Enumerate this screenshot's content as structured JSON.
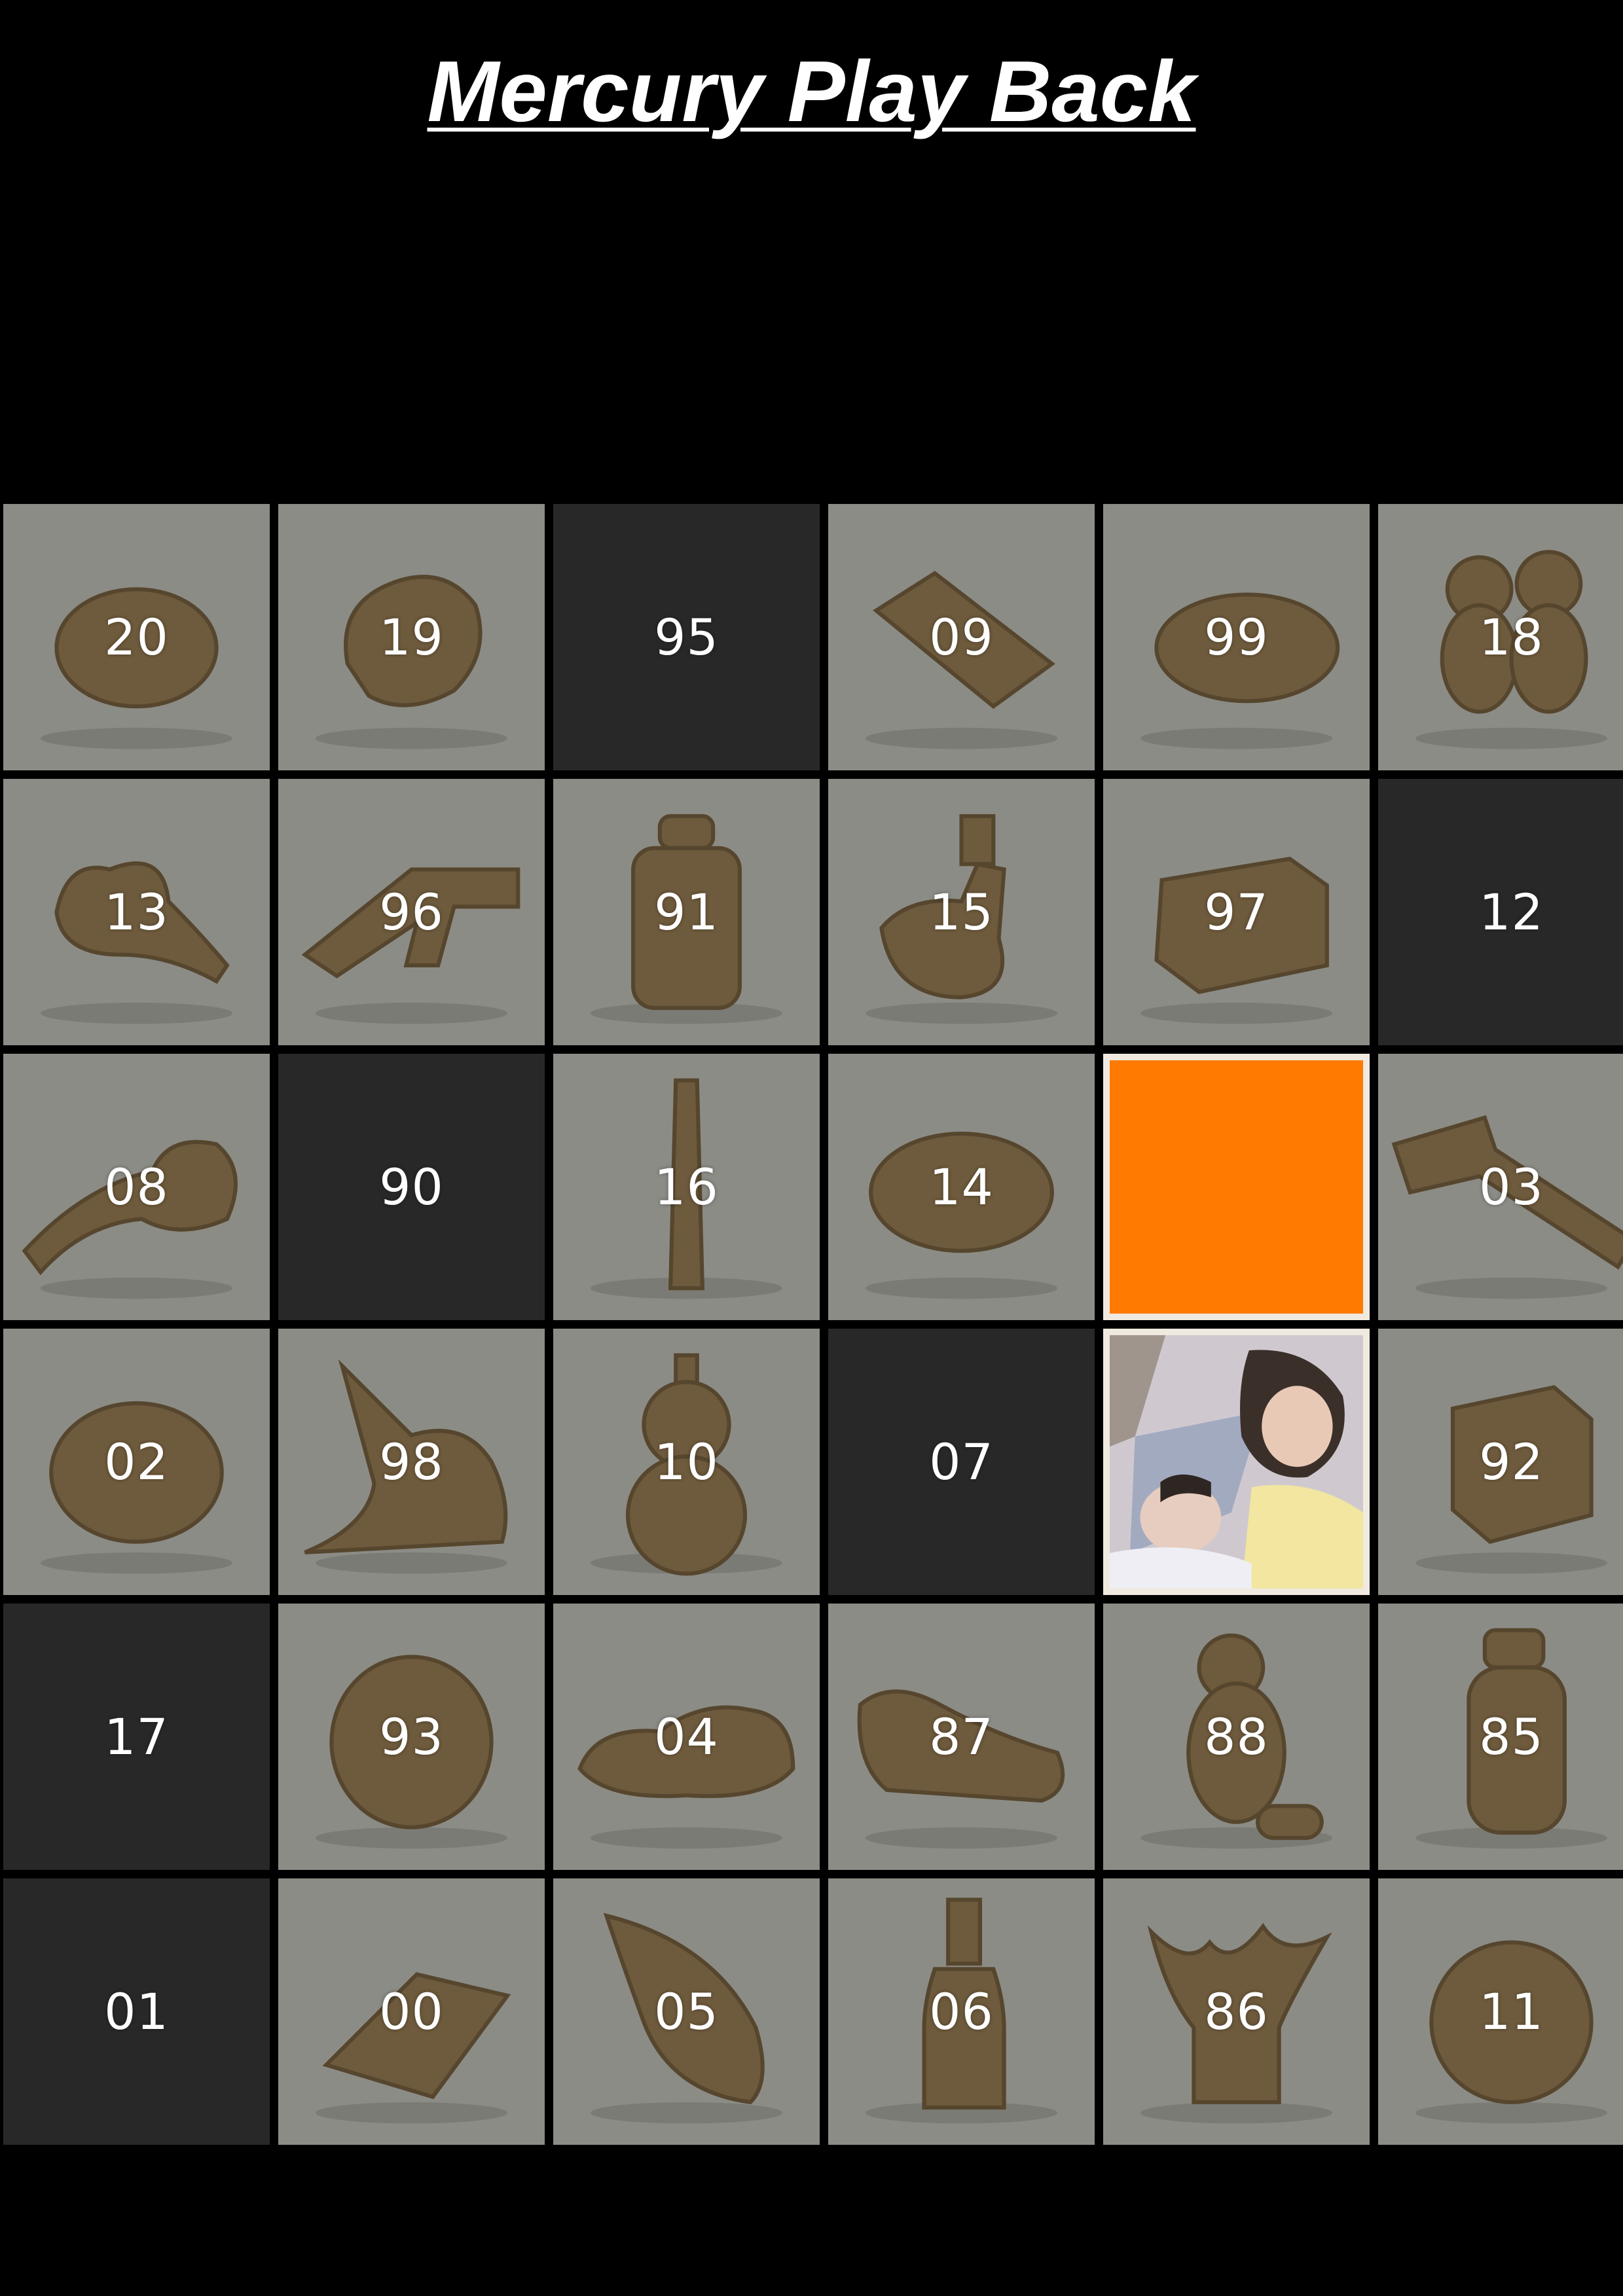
{
  "header": {
    "title": "Mercury Play Back"
  },
  "colors": {
    "background": "#000000",
    "photo_tile": "#8c8c86",
    "empty_tile": "#282828",
    "accent_tile": "#ff7a00",
    "highlight_border": "#efe9df",
    "clay": "#6e5a3c"
  },
  "grid": {
    "rows": [
      [
        {
          "label": "20",
          "kind": "photo",
          "object": "lump-icon"
        },
        {
          "label": "19",
          "kind": "photo",
          "object": "crumpled-lump-icon"
        },
        {
          "label": "95",
          "kind": "empty",
          "object": ""
        },
        {
          "label": "09",
          "kind": "photo",
          "object": "slab-icon"
        },
        {
          "label": "99",
          "kind": "photo",
          "object": "bread-icon"
        },
        {
          "label": "18",
          "kind": "photo",
          "object": "teddy-bears-icon"
        }
      ],
      [
        {
          "label": "13",
          "kind": "photo",
          "object": "pear-shape-icon"
        },
        {
          "label": "96",
          "kind": "photo",
          "object": "pistol-icon"
        },
        {
          "label": "91",
          "kind": "photo",
          "object": "bottle-jar-icon"
        },
        {
          "label": "15",
          "kind": "photo",
          "object": "duck-icon"
        },
        {
          "label": "97",
          "kind": "photo",
          "object": "stacked-blocks-icon"
        },
        {
          "label": "12",
          "kind": "empty",
          "object": ""
        }
      ],
      [
        {
          "label": "08",
          "kind": "photo",
          "object": "horn-icon"
        },
        {
          "label": "90",
          "kind": "empty",
          "object": ""
        },
        {
          "label": "16",
          "kind": "photo",
          "object": "twisted-stick-icon"
        },
        {
          "label": "14",
          "kind": "photo",
          "object": "donut-icon"
        },
        {
          "label": "",
          "kind": "accent",
          "object": ""
        },
        {
          "label": "03",
          "kind": "photo",
          "object": "hammer-icon"
        }
      ],
      [
        {
          "label": "02",
          "kind": "photo",
          "object": "round-lump-icon"
        },
        {
          "label": "98",
          "kind": "photo",
          "object": "bird-head-icon"
        },
        {
          "label": "10",
          "kind": "photo",
          "object": "gourd-icon"
        },
        {
          "label": "07",
          "kind": "empty",
          "object": ""
        },
        {
          "label": "",
          "kind": "portrait",
          "object": "portrait-photo-icon"
        },
        {
          "label": "92",
          "kind": "photo",
          "object": "box-icon"
        }
      ],
      [
        {
          "label": "17",
          "kind": "empty",
          "object": ""
        },
        {
          "label": "93",
          "kind": "photo",
          "object": "ball-icon"
        },
        {
          "label": "04",
          "kind": "photo",
          "object": "clog-shoe-icon"
        },
        {
          "label": "87",
          "kind": "photo",
          "object": "sneaker-icon"
        },
        {
          "label": "88",
          "kind": "photo",
          "object": "teddy-bear-icon"
        },
        {
          "label": "85",
          "kind": "photo",
          "object": "jar-icon"
        }
      ],
      [
        {
          "label": "01",
          "kind": "empty",
          "object": ""
        },
        {
          "label": "00",
          "kind": "photo",
          "object": "brick-icon"
        },
        {
          "label": "05",
          "kind": "photo",
          "object": "seashell-icon"
        },
        {
          "label": "06",
          "kind": "photo",
          "object": "bottle-icon"
        },
        {
          "label": "86",
          "kind": "photo",
          "object": "tree-stump-icon"
        },
        {
          "label": "11",
          "kind": "photo",
          "object": "apple-icon"
        }
      ]
    ]
  }
}
